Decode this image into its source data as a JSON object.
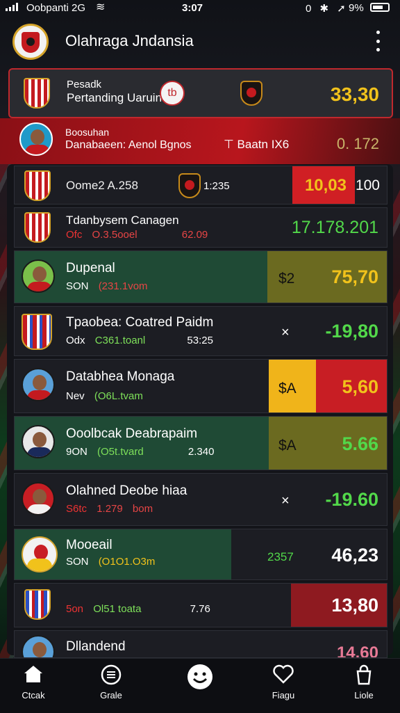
{
  "status": {
    "carrier": "Oobpanti 2G",
    "time": "3:07",
    "icons": "0 ✱ ➚",
    "battery": "9%"
  },
  "app": {
    "title": "Olahraga Jndansia"
  },
  "featured": {
    "line1": "Pesadk",
    "line2": "Pertanding Uaruin",
    "button": "tb",
    "value": "33,30"
  },
  "sub": {
    "line1": "Boosuhan",
    "line2": "Danabaeen: Aenol Bgnos",
    "middle": "Baatn IX6",
    "value": "0. 172"
  },
  "rows": [
    {
      "name": "Oome2 A.258",
      "meta_mid": "1:235",
      "value": "10,03",
      "value2": "100"
    },
    {
      "name": "Tdanbysem Canagen",
      "meta_a": "Ofc",
      "meta_b": "O.3.5ooel",
      "meta_c": "62.09",
      "value": "17.178.201"
    },
    {
      "name": "Dupenal",
      "meta_a": "SON",
      "meta_b": "(231.1vom",
      "box": "$2",
      "value": "75,70"
    },
    {
      "name": "Tpaobea: Coatred Paidm",
      "meta_a": "Odx",
      "meta_b": "C361.toanl",
      "meta_c": "53:25",
      "mark": "×",
      "value": "-19,80"
    },
    {
      "name": "Databhea Monaga",
      "meta_a": "Nev",
      "meta_b": "(O6L.tvam",
      "box": "$A",
      "value": "5,60"
    },
    {
      "name": "Ooolbcak Deabrapaim",
      "meta_a": "9ON",
      "meta_b": "(O5t.tvard",
      "meta_c": "2.340",
      "box": "$A",
      "value": "5.66"
    },
    {
      "name": "Olahned Deobe hiaa",
      "meta_a": "S6tc",
      "meta_b": "1.279",
      "meta_c": "bom",
      "mark": "×",
      "value": "-19.60"
    },
    {
      "name": "Mooeail",
      "meta_a": "SON",
      "meta_b": "(O1O1.O3m",
      "box": "2357",
      "value": "46,23"
    },
    {
      "name": "",
      "meta_a": "5on",
      "meta_b": "Ol51 toata",
      "meta_c": "7.76",
      "value": "13,80"
    },
    {
      "name": "Dllandend",
      "value": "14.60"
    }
  ],
  "nav": [
    {
      "label": "Ctcak",
      "icon": "home-icon"
    },
    {
      "label": "Grale",
      "icon": "ball-icon"
    },
    {
      "label": "",
      "icon": "smile-icon"
    },
    {
      "label": "Fiagu",
      "icon": "heart-icon"
    },
    {
      "label": "Liole",
      "icon": "bag-icon"
    }
  ],
  "colors": {
    "accent_red": "#c0282d",
    "accent_green": "#52d84a",
    "accent_yellow": "#f1c21b",
    "panel": "#1c1d23"
  }
}
